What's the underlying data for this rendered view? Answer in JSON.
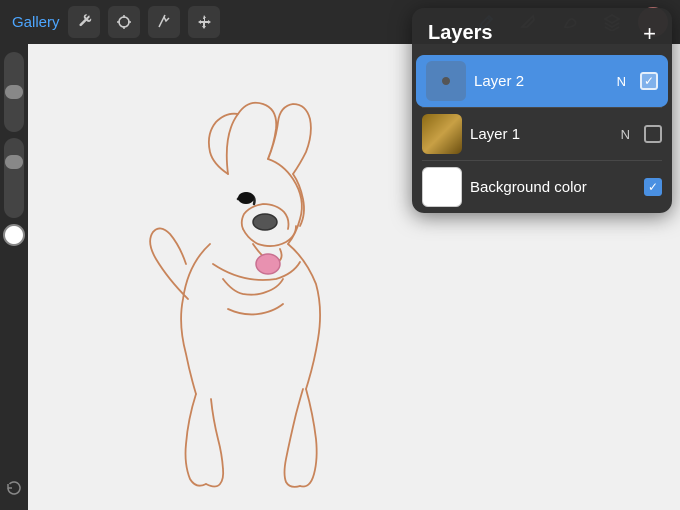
{
  "toolbar": {
    "gallery_label": "Gallery",
    "tools": [
      {
        "name": "wrench",
        "symbol": "🔧"
      },
      {
        "name": "adjust",
        "symbol": "✦"
      },
      {
        "name": "smudge",
        "symbol": "S"
      },
      {
        "name": "move",
        "symbol": "➤"
      }
    ],
    "right_tools": [
      {
        "name": "pencil",
        "symbol": "✏"
      },
      {
        "name": "eraser",
        "symbol": "◎"
      },
      {
        "name": "smear",
        "symbol": "⌇"
      },
      {
        "name": "layers",
        "symbol": "⧉"
      }
    ]
  },
  "layers_panel": {
    "title": "Layers",
    "add_button": "+",
    "layers": [
      {
        "id": "layer2",
        "name": "Layer 2",
        "blend": "N",
        "active": true,
        "checked": true
      },
      {
        "id": "layer1",
        "name": "Layer 1",
        "blend": "N",
        "active": false,
        "checked": false
      },
      {
        "id": "background",
        "name": "Background color",
        "blend": "",
        "active": false,
        "checked": true
      }
    ]
  }
}
